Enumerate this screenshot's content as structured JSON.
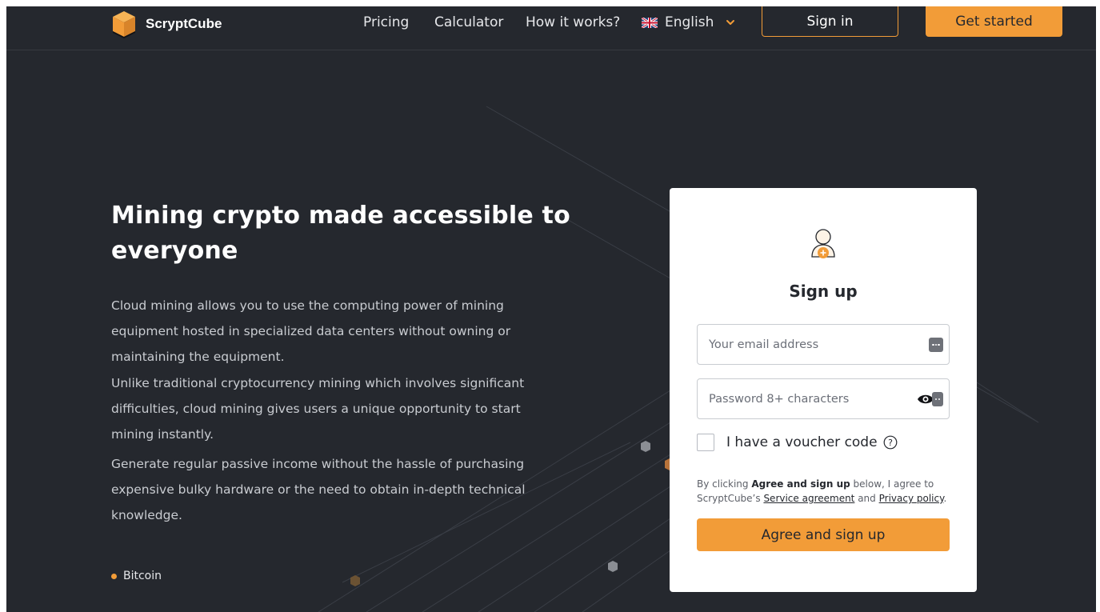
{
  "brand": {
    "name": "ScryptCube",
    "accent": "#f29c38",
    "background": "#25282e"
  },
  "nav": {
    "items": [
      {
        "label": "Pricing"
      },
      {
        "label": "Calculator"
      },
      {
        "label": "How it works?"
      }
    ],
    "language": {
      "label": "English",
      "flag": "uk-flag-icon"
    },
    "signin_label": "Sign in",
    "getstarted_label": "Get started"
  },
  "hero": {
    "title": "Mining crypto made accessible to everyone",
    "paragraphs": [
      "Cloud mining allows you to use the computing power of mining equipment hosted in specialized data centers without owning or maintaining the equipment.",
      "Unlike traditional cryptocurrency mining which involves significant difficulties, cloud mining gives users a unique opportunity to start mining instantly.",
      "Generate regular passive income without the hassle of purchasing expensive bulky hardware or the need to obtain in-depth technical knowledge."
    ],
    "coin_label": "Bitcoin"
  },
  "signup": {
    "title": "Sign up",
    "email_placeholder": "Your email address",
    "password_placeholder": "Password 8+ characters",
    "voucher_label": "I have a voucher code",
    "legal_prefix": "By clicking ",
    "legal_action": "Agree and sign up",
    "legal_middle": " below, I agree to ScryptCube’s ",
    "service_link": "Service agreement",
    "legal_and": " and ",
    "privacy_link": "Privacy policy",
    "legal_end": ".",
    "submit_label": "Agree and sign up"
  }
}
